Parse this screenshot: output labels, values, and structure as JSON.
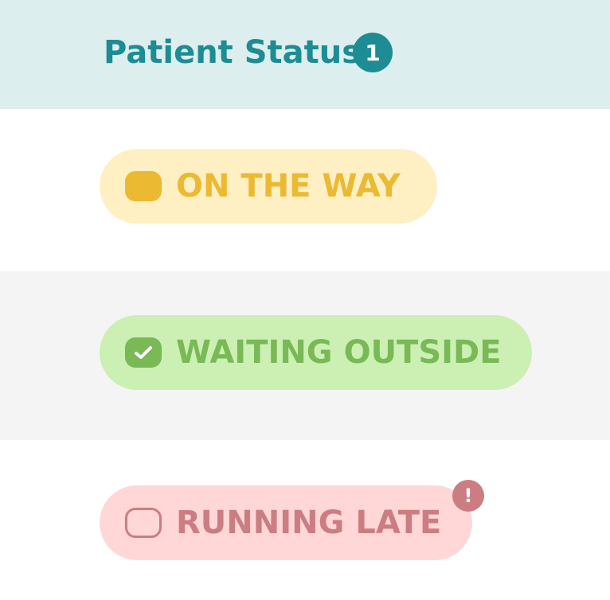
{
  "header": {
    "title": "Patient Status",
    "badge_count": "1",
    "background": "#dceeee",
    "accent": "#1d8c94"
  },
  "statuses": [
    {
      "label": "ON THE WAY",
      "icon": "filled-toggle-icon",
      "pill_color": "#fff0c4",
      "text_color": "#ecb932"
    },
    {
      "label": "WAITING OUTSIDE",
      "icon": "checkbox-checked-icon",
      "pill_color": "#ccf0b4",
      "text_color": "#79b956"
    },
    {
      "label": "RUNNING LATE",
      "icon": "checkbox-empty-icon",
      "pill_color": "#ffd7d7",
      "text_color": "#cc7d81",
      "alert": "!"
    }
  ]
}
